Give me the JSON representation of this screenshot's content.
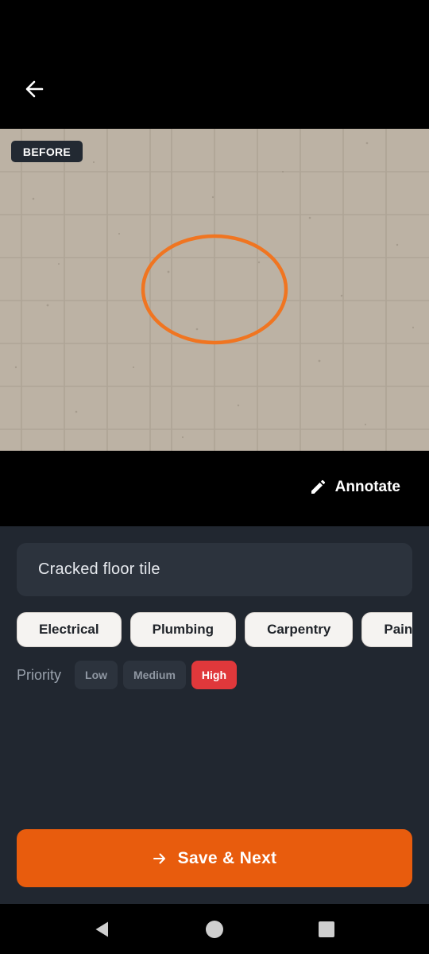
{
  "photo": {
    "badge": "BEFORE"
  },
  "toolbar": {
    "annotate_label": "Annotate"
  },
  "form": {
    "description": "Cracked floor tile",
    "categories": [
      "Electrical",
      "Plumbing",
      "Carpentry",
      "Painting"
    ],
    "priority_label": "Priority",
    "priority_options": [
      "Low",
      "Medium",
      "High"
    ],
    "priority_selected": "High"
  },
  "actions": {
    "save_label": "Save & Next"
  },
  "colors": {
    "accent": "#e85c0d",
    "annotation_ring": "#f07521",
    "priority_high": "#e0383b",
    "panel_bg": "#212730"
  },
  "icons": {
    "back": "arrow-left-icon",
    "annotate": "pencil-icon",
    "save": "arrow-right-icon",
    "nav_back": "triangle-back-icon",
    "nav_home": "circle-home-icon",
    "nav_recents": "square-recents-icon"
  }
}
